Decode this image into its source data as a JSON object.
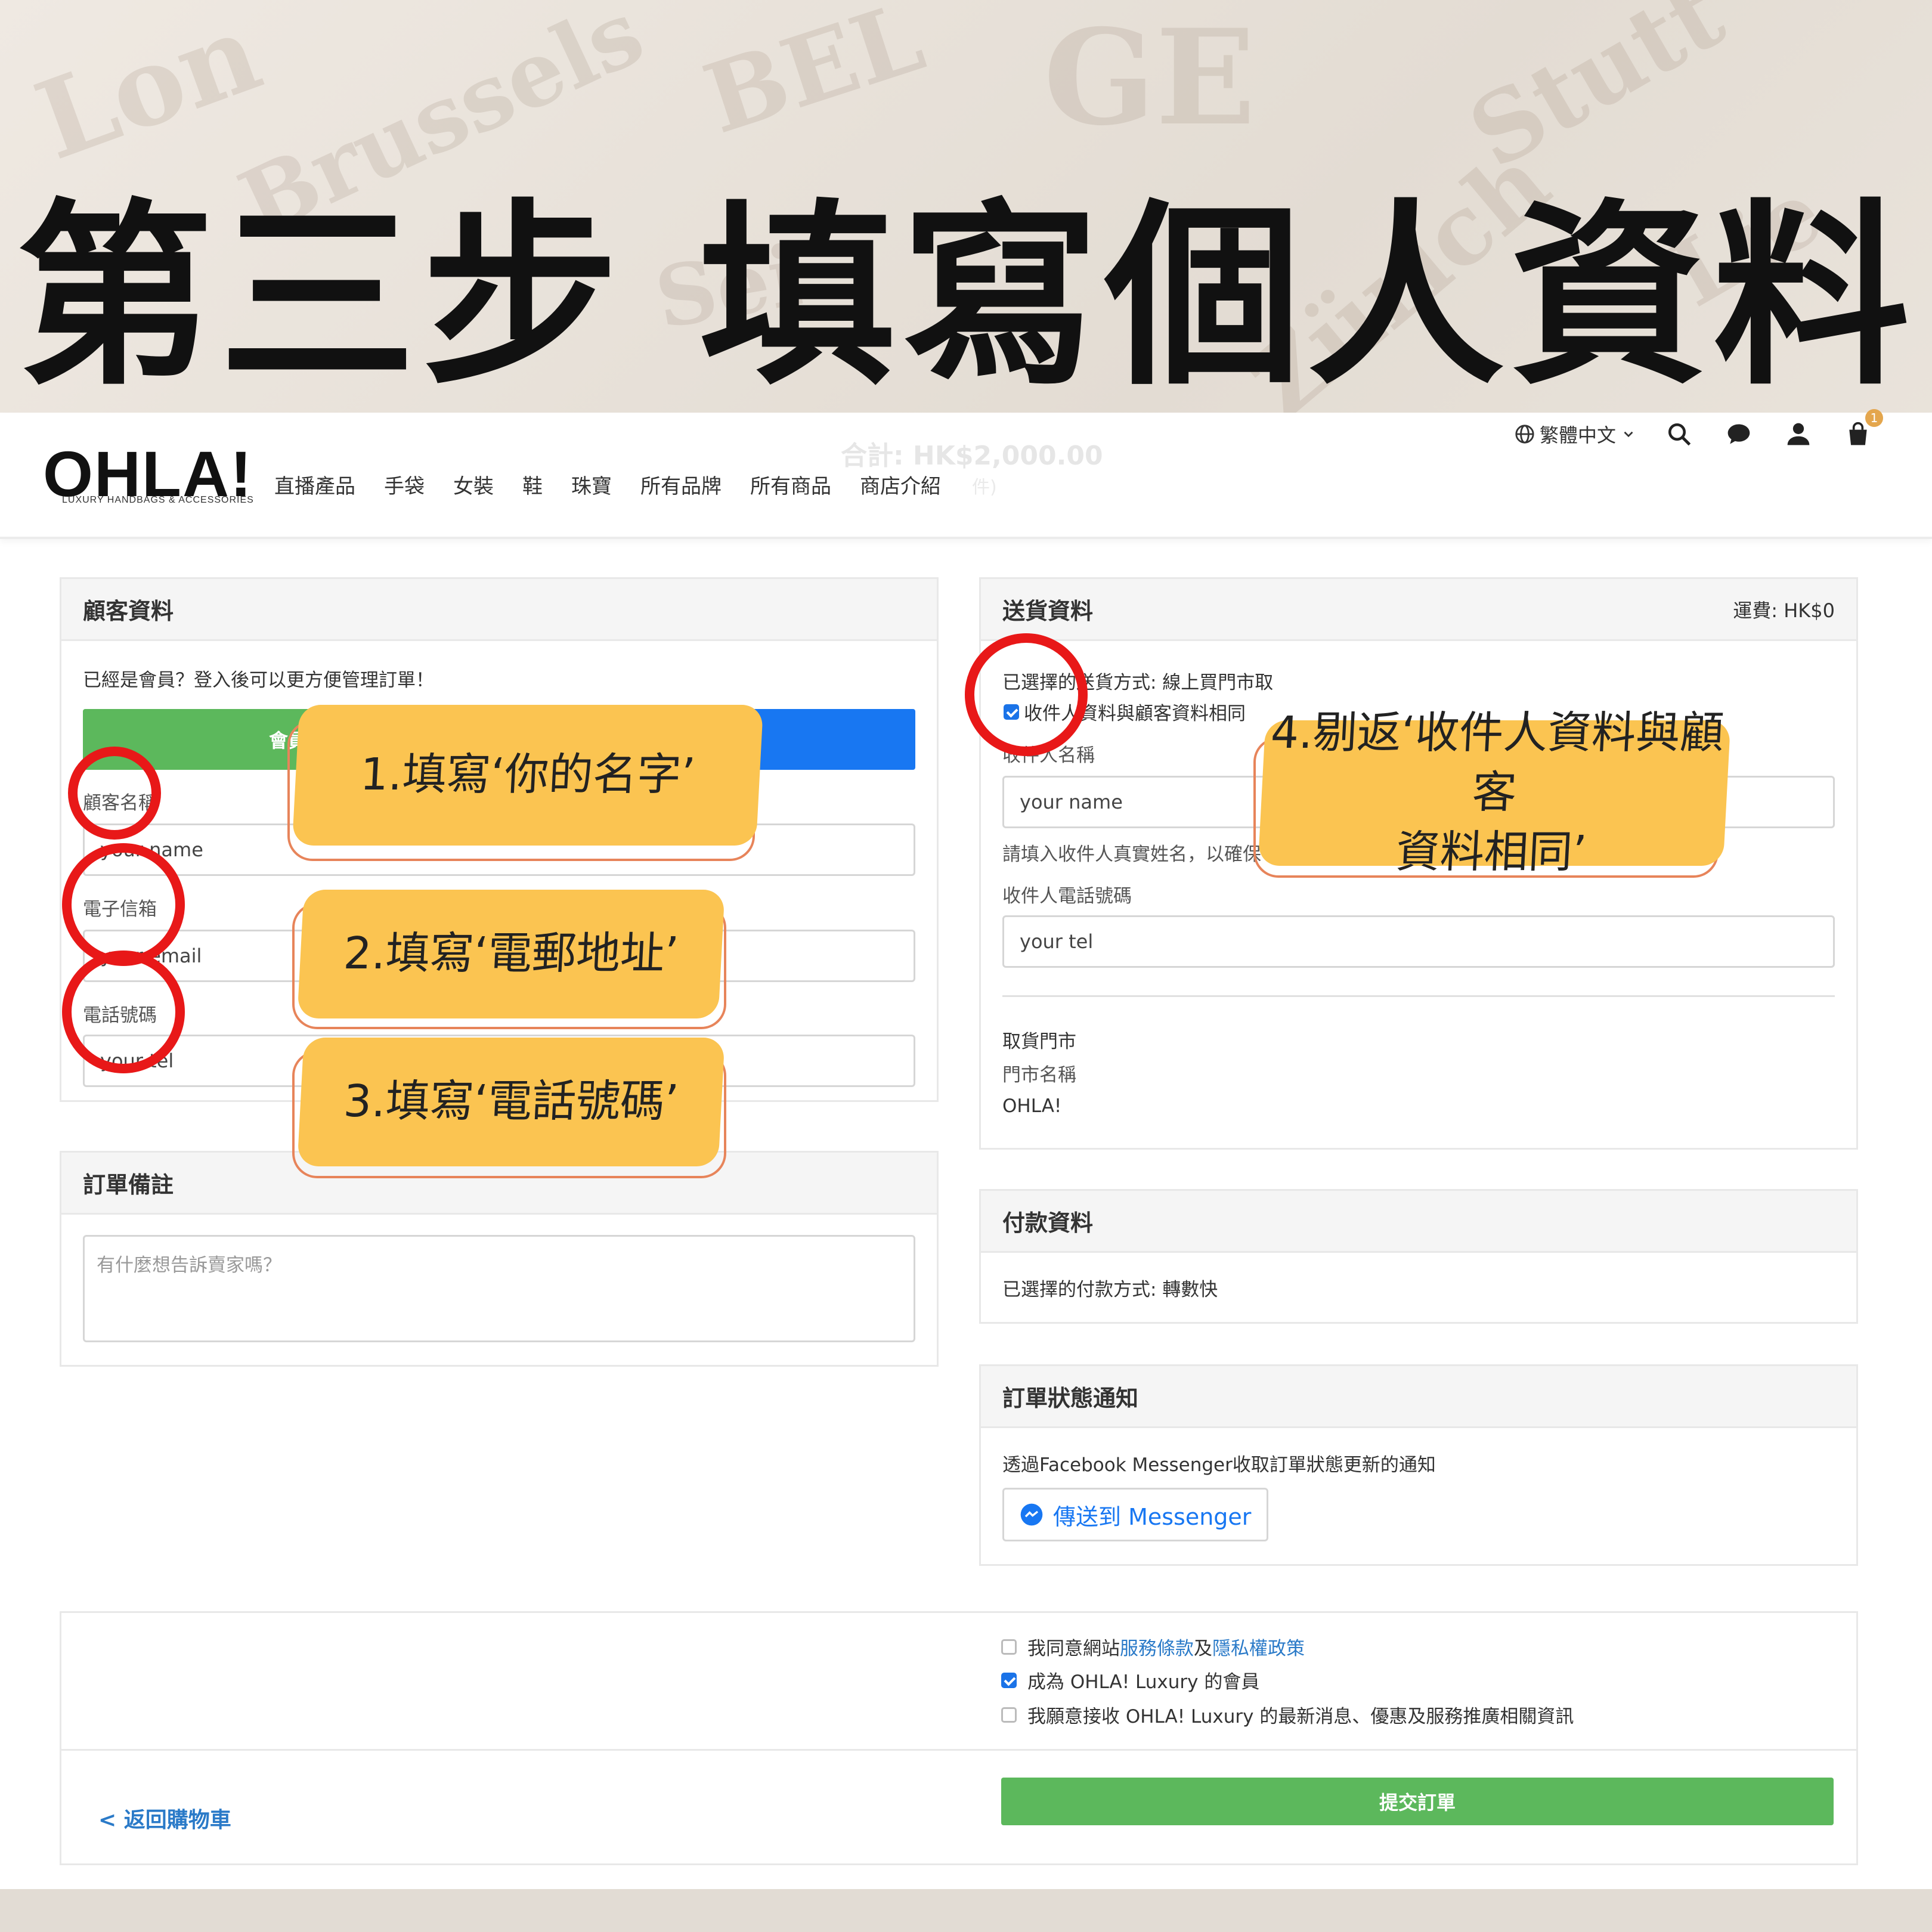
{
  "headline": "第三步 填寫個人資料",
  "header": {
    "logo": "OHLA!",
    "logo_tagline": "LUXURY HANDBAGS & ACCESSORIES",
    "nav": [
      "直播產品",
      "手袋",
      "女裝",
      "鞋",
      "珠寶",
      "所有品牌",
      "所有商品",
      "商店介紹"
    ],
    "ghost_total": "合計: HK$2,000.00",
    "ghost_small": "件)",
    "language": "繁體中文",
    "cart_count": "1",
    "icons": [
      "globe-icon",
      "search-icon",
      "chat-icon",
      "user-icon",
      "cart-icon"
    ]
  },
  "customer": {
    "title": "顧客資料",
    "member_prompt": "已經是會員？登入後可以更方便管理訂單！",
    "member_login_button": "會員",
    "name_label": "顧客名稱",
    "name_placeholder": "your name",
    "email_label": "電子信箱",
    "email_placeholder": "your email",
    "phone_label": "電話號碼",
    "phone_placeholder": "your tel"
  },
  "order_note": {
    "title": "訂單備註",
    "placeholder": "有什麼想告訴賣家嗎？"
  },
  "shipping": {
    "title": "送貨資料",
    "fee": "運費: HK$0",
    "method": "已選擇的送貨方式: 線上買門市取",
    "same_as_customer": "收件人資料與顧客資料相同",
    "recipient_name_label": "收件人名稱",
    "recipient_name_placeholder": "your name",
    "recipient_name_hint": "請填入收件人真實姓名，以確保",
    "recipient_phone_label": "收件人電話號碼",
    "recipient_phone_placeholder": "your tel",
    "pickup_store_label": "取貨門市",
    "store_name_label": "門市名稱",
    "store_name": "OHLA!"
  },
  "payment": {
    "title": "付款資料",
    "method": "已選擇的付款方式: 轉數快"
  },
  "notification": {
    "title": "訂單狀態通知",
    "description": "透過Facebook Messenger收取訂單狀態更新的通知",
    "messenger_button": "傳送到 Messenger"
  },
  "agreements": {
    "terms_prefix": "我同意網站",
    "terms_link": "服務條款",
    "terms_and": "及",
    "privacy_link": "隱私權政策",
    "become_member": "成為 OHLA! Luxury 的會員",
    "newsletter": "我願意接收 OHLA! Luxury 的最新消息、優惠及服務推廣相關資訊"
  },
  "checkbox_states": {
    "same_as_customer": true,
    "terms": false,
    "member": true,
    "newsletter": false
  },
  "footer": {
    "back_link": "< 返回購物車",
    "submit_button": "提交訂單"
  },
  "annotations": {
    "step1": "1.填寫‘你的名字’",
    "step2": "2.填寫‘電郵地址’",
    "step3": "3.填寫‘電話號碼’",
    "step4_line1": "4.剔返‘收件人資料與顧客",
    "step4_line2": "資料相同’"
  },
  "colors": {
    "callout": "#fbc451",
    "ring": "#e81818",
    "green": "#5cb85c",
    "blue": "#1877f2",
    "link": "#2a7ac8"
  }
}
